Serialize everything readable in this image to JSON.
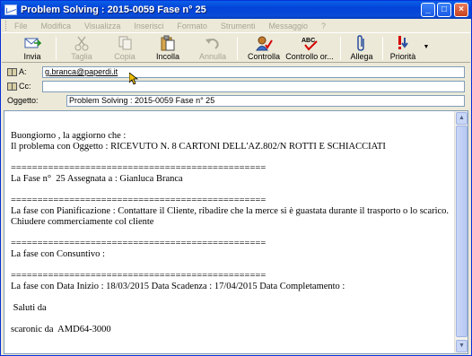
{
  "window": {
    "title": "Problem Solving :  2015-0059  Fase n°  25"
  },
  "menu": [
    "File",
    "Modifica",
    "Visualizza",
    "Inserisci",
    "Formato",
    "Strumenti",
    "Messaggio",
    "?"
  ],
  "toolbar": {
    "send": "Invia",
    "cut": "Taglia",
    "copy": "Copia",
    "paste": "Incolla",
    "undo": "Annulla",
    "check": "Controlla",
    "spelling": "Controllo or...",
    "attach": "Allega",
    "priority": "Priorità"
  },
  "fields": {
    "to_label": "A:",
    "to_value": "g.branca@paperdi.it",
    "cc_label": "Cc:",
    "cc_value": "",
    "subject_label": "Oggetto:",
    "subject_value": "Problem Solving :  2015-0059  Fase n°  25"
  },
  "body": {
    "lines": [
      "Buongiorno , la aggiorno che :",
      "Il problema con Oggetto : RICEVUTO N. 8 CARTONI DELL'AZ.802/N ROTTI E SCHIACCIATI",
      "",
      "================================================",
      "La Fase n°  25 Assegnata a : Gianluca Branca",
      "",
      "================================================",
      "La fase con Pianificazione : Contattare il Cliente, ribadire che la merce si è guastata durante il trasporto o lo scarico. Chiudere commerciamente col cliente",
      "",
      "================================================",
      "La fase con Consuntivo :",
      "",
      "================================================",
      "La fase con Data Inizio : 18/03/2015 Data Scadenza : 17/04/2015 Data Completamento :",
      "",
      " Saluti da",
      "",
      "scaronic da  AMD64-3000"
    ]
  },
  "colors": {
    "titlebar": "#0343d8",
    "priority_red": "#d40000",
    "window_bg": "#ece9d8"
  }
}
